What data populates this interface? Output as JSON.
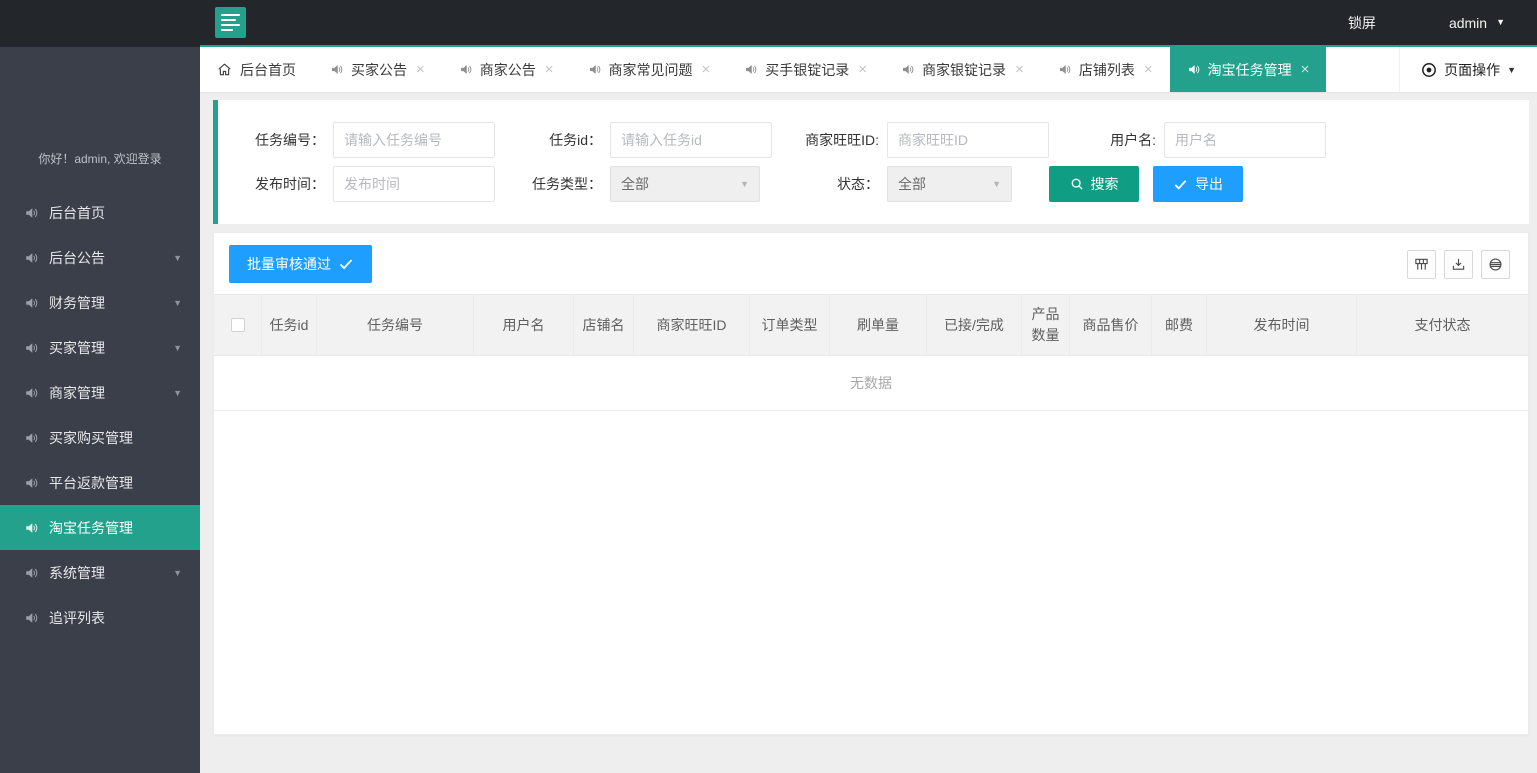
{
  "topbar": {
    "lock_label": "锁屏",
    "user_label": "admin"
  },
  "sidebar": {
    "welcome": "你好！admin, 欢迎登录",
    "items": [
      {
        "label": "后台首页"
      },
      {
        "label": "后台公告"
      },
      {
        "label": "财务管理"
      },
      {
        "label": "买家管理"
      },
      {
        "label": "商家管理"
      },
      {
        "label": "买家购买管理"
      },
      {
        "label": "平台返款管理"
      },
      {
        "label": "淘宝任务管理"
      },
      {
        "label": "系统管理"
      },
      {
        "label": "追评列表"
      }
    ]
  },
  "tabbar": {
    "tabs": [
      {
        "label": "后台首页"
      },
      {
        "label": "买家公告"
      },
      {
        "label": "商家公告"
      },
      {
        "label": "商家常见问题"
      },
      {
        "label": "买手银锭记录"
      },
      {
        "label": "商家银锭记录"
      },
      {
        "label": "店铺列表"
      },
      {
        "label": "淘宝任务管理"
      }
    ],
    "page_actions_label": "页面操作"
  },
  "filter": {
    "task_no_label": "任务编号：",
    "task_no_placeholder": "请输入任务编号",
    "task_id_label": "任务id：",
    "task_id_placeholder": "请输入任务id",
    "wangwang_label": "商家旺旺ID:",
    "wangwang_placeholder": "商家旺旺ID",
    "username_label": "用户名:",
    "username_placeholder": "用户名",
    "pub_time_label": "发布时间：",
    "pub_time_placeholder": "发布时间",
    "task_type_label": "任务类型：",
    "task_type_value": "全部",
    "status_label": "状态：",
    "status_value": "全部",
    "search_label": "搜索",
    "export_label": "导出"
  },
  "table": {
    "batch_approve_label": "批量审核通过",
    "columns": [
      "任务id",
      "任务编号",
      "用户名",
      "店铺名",
      "商家旺旺ID",
      "订单类型",
      "刷单量",
      "已接/完成",
      "产品数量",
      "商品售价",
      "邮费",
      "发布时间",
      "支付状态"
    ],
    "empty_text": "无数据"
  },
  "icons": {
    "close": "×",
    "caret_down": "▼"
  },
  "colors": {
    "accent_teal": "#23a18c",
    "button_blue": "#1e9fff",
    "search_green": "#0f9d84",
    "topbar_dark": "#23262b",
    "sidebar_dark": "#3a3f4a",
    "table_header_bg": "#f2f2f2"
  }
}
